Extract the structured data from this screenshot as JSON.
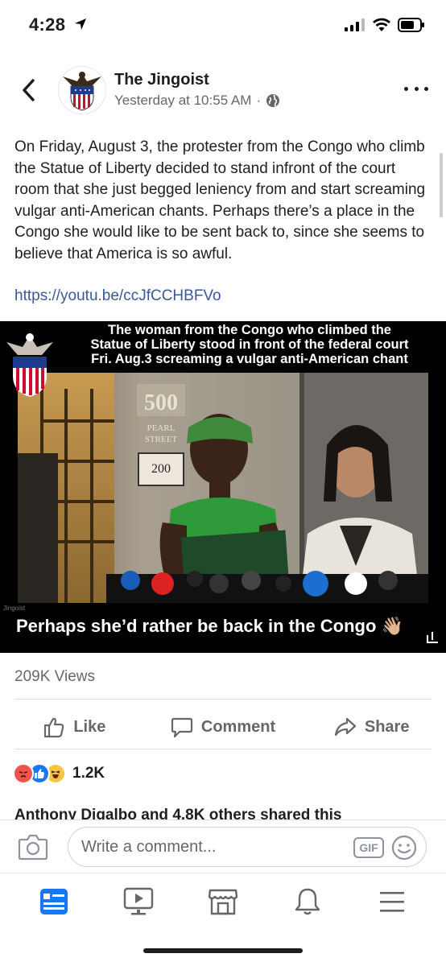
{
  "status_bar": {
    "time": "4:28"
  },
  "post": {
    "page_name": "The Jingoist",
    "timestamp": "Yesterday at 10:55 AM",
    "meta_separator": "·",
    "body": "On Friday, August 3, the protester from the Congo who climb the Statue of Liberty decided to stand infront of the court room that she just begged leniency from and start screaming vulgar anti-American chants. Perhaps there’s a place in the Congo she would like to be sent back to, since she seems to believe that America is so awful.",
    "link": "https://youtu.be/ccJfCCHBFVo"
  },
  "video": {
    "caption_top_1": "The woman from the Congo who climbed the",
    "caption_top_2": "Statue of Liberty stood in front of the federal court",
    "caption_top_3": "Fri. Aug.3  screaming a vulgar anti-American chant",
    "caption_bottom": "Perhaps she’d rather be back in the Congo 👋🏼",
    "building_number": "500",
    "street_sign_1": "PEARL",
    "street_sign_2": "STREET",
    "address_number": "200",
    "watermark": "Jingoist"
  },
  "stats": {
    "views": "209K Views",
    "reactions_count": "1.2K",
    "shared_line": "Anthony Digalbo and 4.8K others shared this"
  },
  "actions": {
    "like": "Like",
    "comment": "Comment",
    "share": "Share"
  },
  "comment_bar": {
    "placeholder": "Write a comment...",
    "gif": "GIF"
  },
  "colors": {
    "link": "#385898",
    "accent": "#1877f2",
    "secondary_text": "#65676b"
  }
}
